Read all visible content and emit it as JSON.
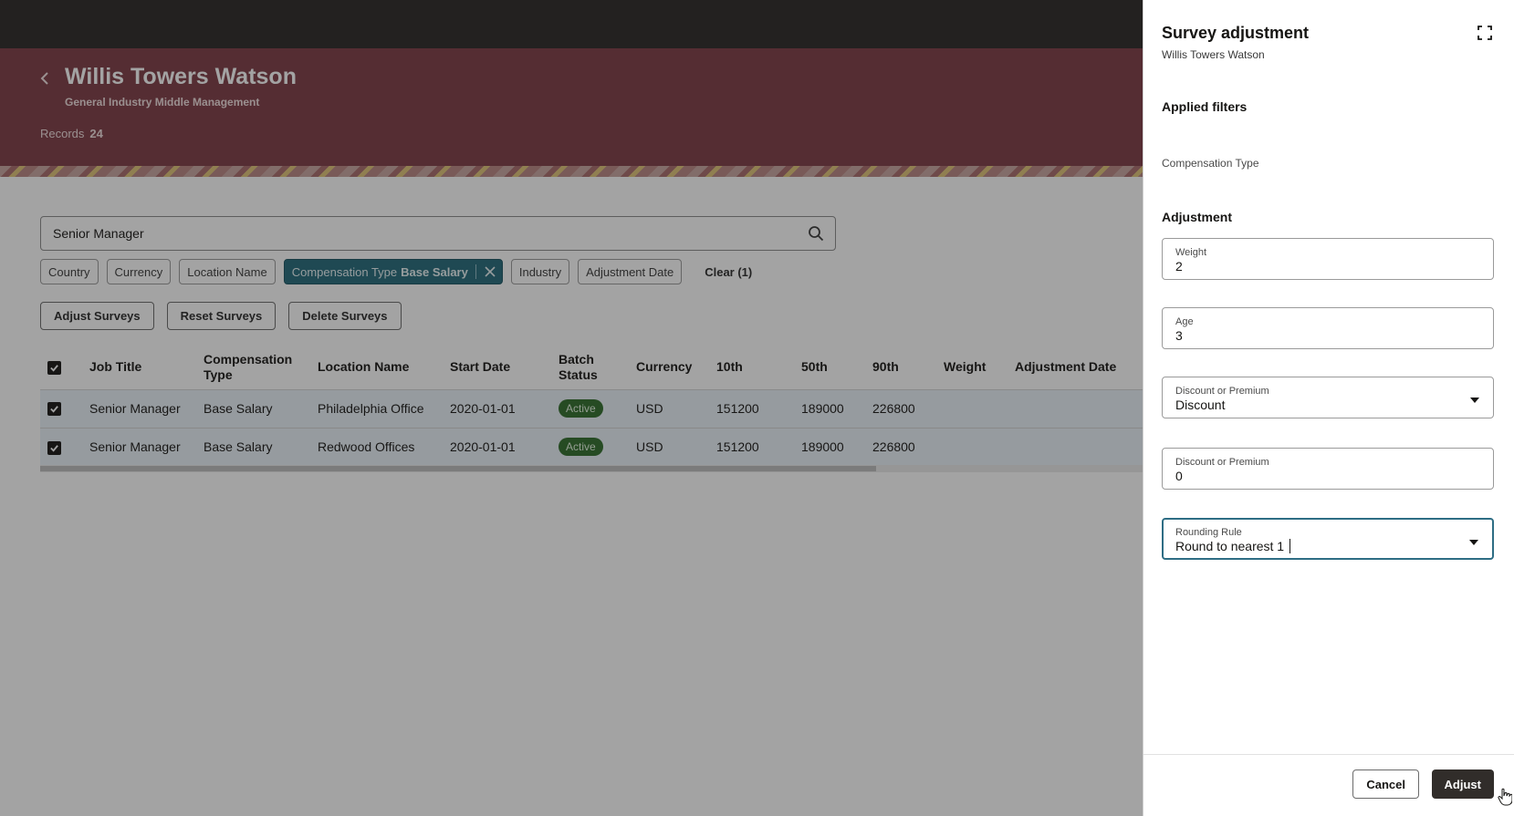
{
  "header": {
    "title": "Willis Towers Watson",
    "subtitle": "General Industry Middle Management",
    "records_label": "Records",
    "records_count": "24"
  },
  "search": {
    "value": "Senior Manager"
  },
  "filters": {
    "country": "Country",
    "currency": "Currency",
    "location_name": "Location Name",
    "compensation_type_label": "Compensation Type",
    "compensation_type_value": "Base Salary",
    "industry": "Industry",
    "adjustment_date": "Adjustment Date",
    "clear": "Clear (1)"
  },
  "actions": {
    "adjust": "Adjust Surveys",
    "reset": "Reset Surveys",
    "delete": "Delete Surveys"
  },
  "table": {
    "columns": {
      "job_title": "Job Title",
      "comp_type_1": "Compensation",
      "comp_type_2": "Type",
      "location": "Location Name",
      "start_date": "Start Date",
      "batch_1": "Batch",
      "batch_2": "Status",
      "currency": "Currency",
      "p10": "10th",
      "p50": "50th",
      "p90": "90th",
      "weight": "Weight",
      "adjustment_date": "Adjustment Date"
    },
    "rows": [
      {
        "job_title": "Senior Manager",
        "comp_type": "Base Salary",
        "location": "Philadelphia Office",
        "start_date": "2020-01-01",
        "status": "Active",
        "currency": "USD",
        "p10": "151200",
        "p50": "189000",
        "p90": "226800",
        "weight": "",
        "adjustment_date": ""
      },
      {
        "job_title": "Senior Manager",
        "comp_type": "Base Salary",
        "location": "Redwood Offices",
        "start_date": "2020-01-01",
        "status": "Active",
        "currency": "USD",
        "p10": "151200",
        "p50": "189000",
        "p90": "226800",
        "weight": "",
        "adjustment_date": ""
      }
    ]
  },
  "drawer": {
    "title": "Survey adjustment",
    "subtitle": "Willis Towers Watson",
    "applied_filters": "Applied filters",
    "filter_compensation_type": "Compensation Type",
    "adjustment": "Adjustment",
    "weight": {
      "label": "Weight",
      "value": "2"
    },
    "age": {
      "label": "Age",
      "value": "3"
    },
    "discount_select": {
      "label": "Discount or Premium",
      "value": "Discount"
    },
    "discount_value": {
      "label": "Discount or Premium",
      "value": "0"
    },
    "rounding": {
      "label": "Rounding Rule",
      "value": "Round to nearest 1"
    },
    "cancel": "Cancel",
    "adjust": "Adjust"
  },
  "colors": {
    "hero": "#7d3b45",
    "topbar": "#2a2726",
    "chip_active": "#23697a",
    "badge_active": "#2f6d2b",
    "primary_button": "#312d2a",
    "focus_border": "#2e6d84"
  }
}
